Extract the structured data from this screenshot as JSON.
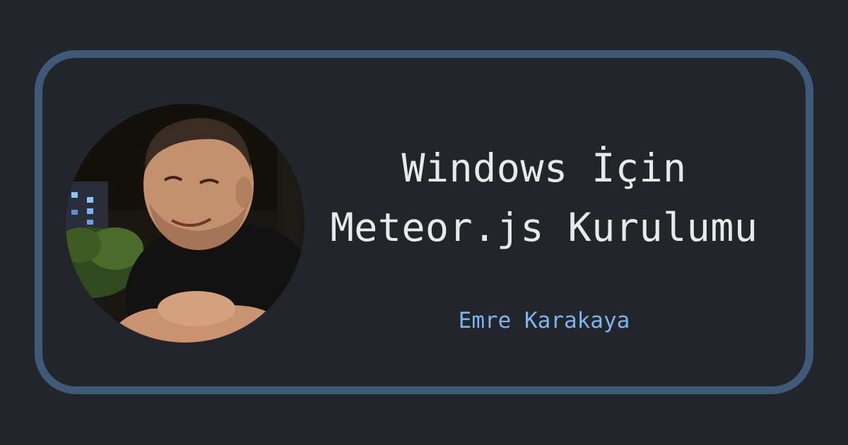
{
  "card": {
    "title_line1": "Windows İçin",
    "title_line2": "Meteor.js Kurulumu",
    "author": "Emre Karakaya"
  },
  "colors": {
    "background": "#22262b",
    "border": "#3f5978",
    "title": "#e8e9eb",
    "author": "#7eb3f0"
  }
}
